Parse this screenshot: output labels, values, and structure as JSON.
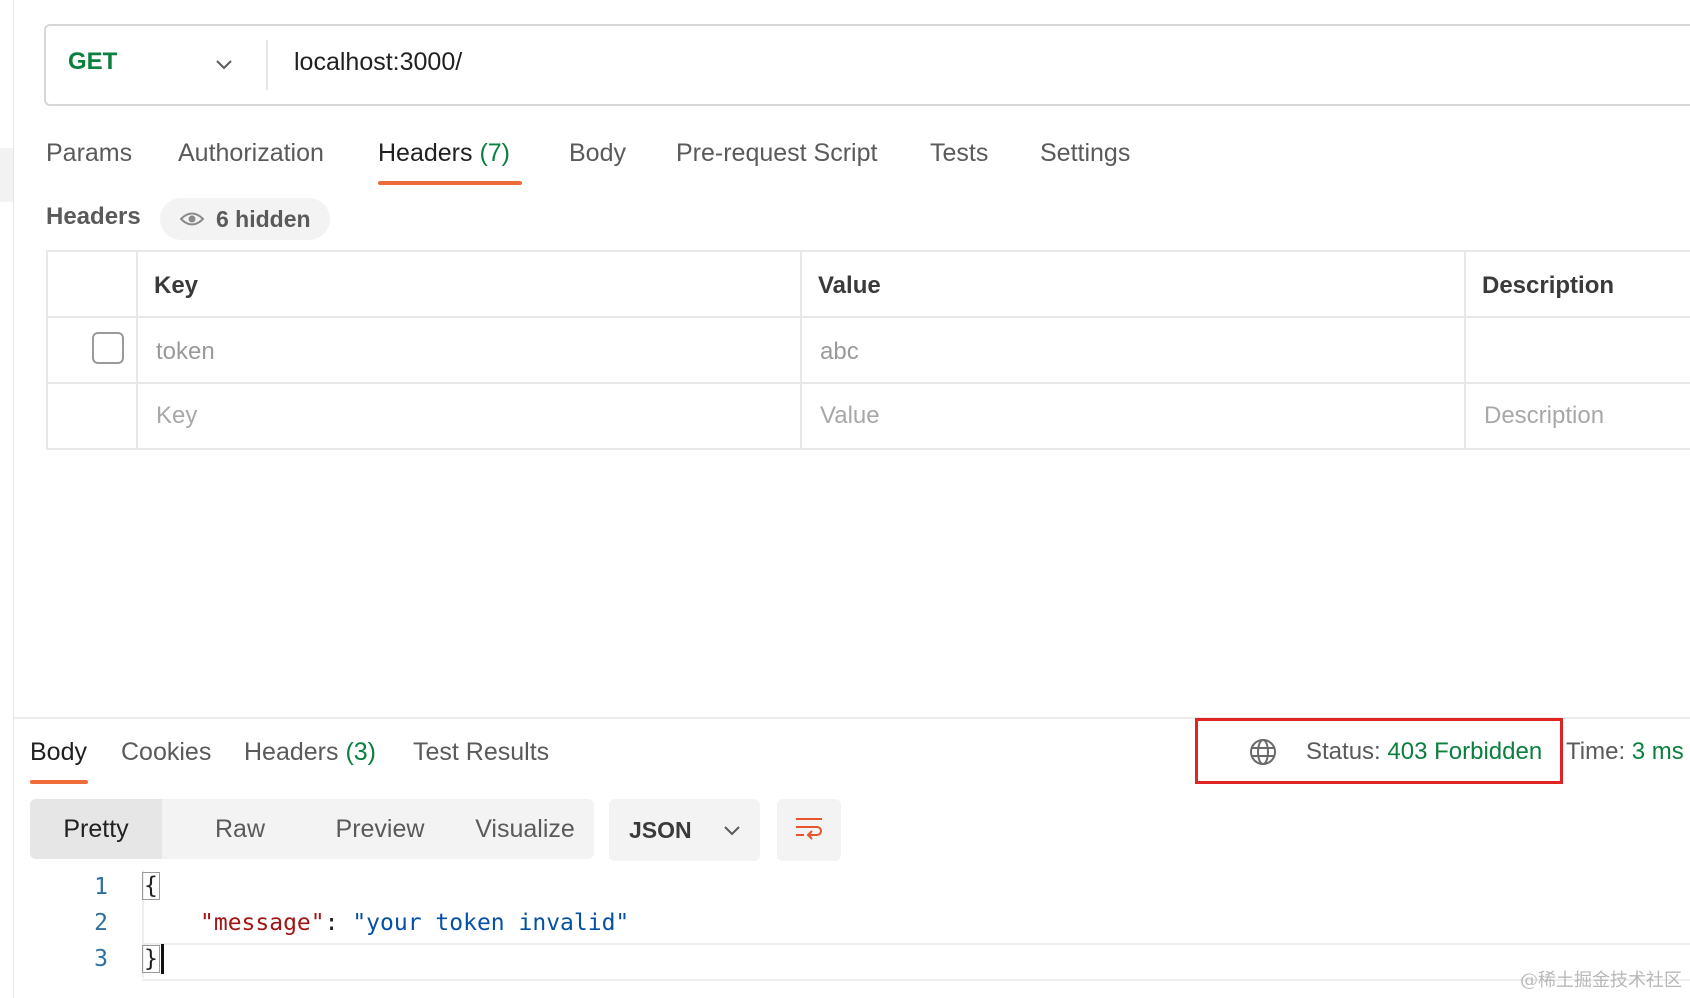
{
  "request": {
    "method": "GET",
    "url": "localhost:3000/"
  },
  "request_tabs": [
    {
      "label": "Params",
      "count": ""
    },
    {
      "label": "Authorization",
      "count": ""
    },
    {
      "label": "Headers",
      "count": "(7)"
    },
    {
      "label": "Body",
      "count": ""
    },
    {
      "label": "Pre-request Script",
      "count": ""
    },
    {
      "label": "Tests",
      "count": ""
    },
    {
      "label": "Settings",
      "count": ""
    }
  ],
  "active_request_tab": "Headers",
  "headers_section": {
    "title": "Headers",
    "hidden_label": "6 hidden"
  },
  "headers_table": {
    "columns": [
      "Key",
      "Value",
      "Description"
    ],
    "rows": [
      {
        "checked": false,
        "key": "token",
        "value": "abc",
        "description": ""
      }
    ],
    "placeholder": {
      "key": "Key",
      "value": "Value",
      "description": "Description"
    }
  },
  "response_tabs": [
    {
      "label": "Body",
      "count": ""
    },
    {
      "label": "Cookies",
      "count": ""
    },
    {
      "label": "Headers",
      "count": "(3)"
    },
    {
      "label": "Test Results",
      "count": ""
    }
  ],
  "active_response_tab": "Body",
  "status": {
    "label": "Status:",
    "value": "403 Forbidden",
    "time_label": "Time:",
    "time_value": "3 ms"
  },
  "view_modes": [
    "Pretty",
    "Raw",
    "Preview",
    "Visualize"
  ],
  "active_view_mode": "Pretty",
  "format": "JSON",
  "code": {
    "line_numbers": [
      "1",
      "2",
      "3"
    ],
    "open_brace": "{",
    "key": "\"message\"",
    "separator": ": ",
    "value": "\"your token invalid\"",
    "close_brace": "}"
  },
  "watermark": "@稀土掘金技术社区",
  "colors": {
    "accent": "#ef6c3a",
    "success": "#0a7f3e",
    "highlight_box": "#e02424"
  },
  "icons": [
    "chevron-down-icon",
    "eye-icon",
    "globe-icon",
    "wrap-lines-icon"
  ]
}
